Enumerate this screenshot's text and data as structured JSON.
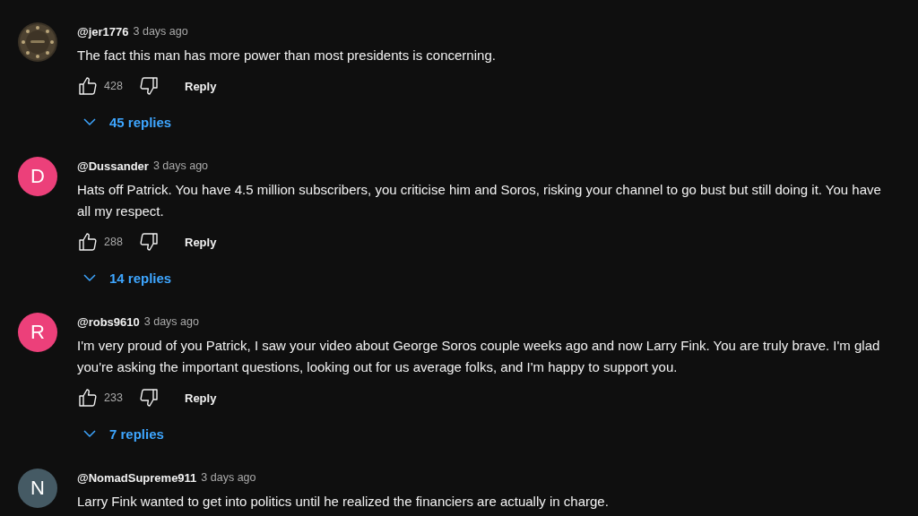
{
  "comments": [
    {
      "author": "@jer1776",
      "time": "3 days ago",
      "text": "The fact this man has more power than most presidents is concerning.",
      "likes": "428",
      "reply_label": "Reply",
      "replies": "45 replies"
    },
    {
      "avatar": {
        "kind": "letter",
        "letter": "D",
        "color": "#ec407a"
      },
      "author": "@Dussander",
      "time": "3 days ago",
      "text": "Hats off Patrick. You have 4.5 million subscribers, you criticise him and Soros, risking your channel to go bust but still doing it. You have all my respect.",
      "likes": "288",
      "reply_label": "Reply",
      "replies": "14 replies"
    },
    {
      "avatar": {
        "kind": "letter",
        "letter": "R",
        "color": "#ec407a"
      },
      "author": "@robs9610",
      "time": "3 days ago",
      "text": "I'm very proud of you Patrick, I saw your video about George Soros couple weeks ago and now Larry Fink. You are truly brave. I'm glad you're asking the important questions, looking out for us average folks, and I'm happy to support you.",
      "likes": "233",
      "reply_label": "Reply",
      "replies": "7 replies"
    },
    {
      "avatar": {
        "kind": "letter",
        "letter": "N",
        "color": "#455a64"
      },
      "author": "@NomadSupreme911",
      "time": "3 days ago",
      "text": "Larry Fink wanted to get into politics until he realized the financiers are actually in charge."
    }
  ]
}
